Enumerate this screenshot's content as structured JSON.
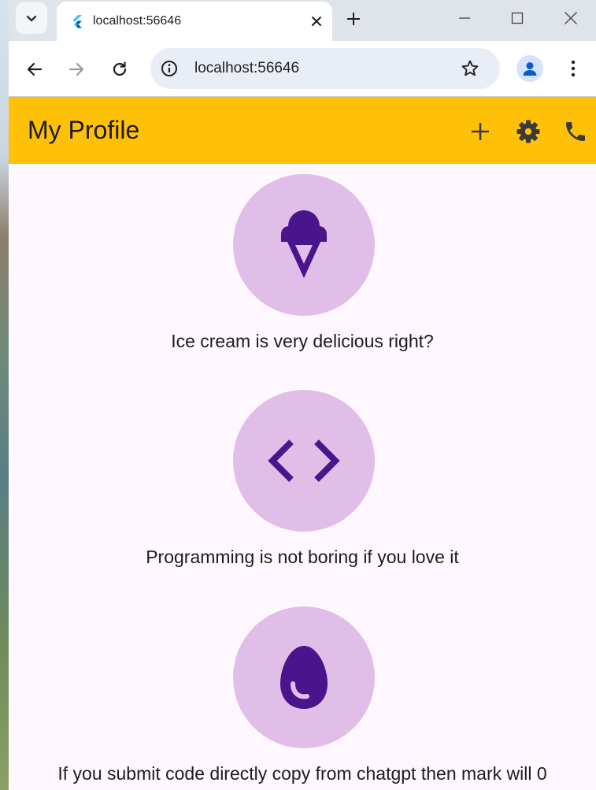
{
  "tab": {
    "title": "localhost:56646"
  },
  "address_bar": {
    "url": "localhost:56646"
  },
  "appbar": {
    "title": "My Profile"
  },
  "icons": {
    "tab_search": "chevron-down-icon",
    "favicon": "flutter-icon",
    "tab_close": "close-icon",
    "new_tab": "plus-icon",
    "back": "arrow-left-icon",
    "forward": "arrow-right-icon",
    "reload": "reload-icon",
    "site_info": "info-icon",
    "bookmark": "star-icon",
    "profile": "account-icon",
    "menu": "more-vertical-icon",
    "appbar_actions": [
      "add-icon",
      "settings-icon",
      "phone-icon"
    ]
  },
  "cards": [
    {
      "icon": "icecream-icon",
      "caption": "Ice cream is very delicious right?"
    },
    {
      "icon": "code-icon",
      "caption": "Programming is not boring if you love it"
    },
    {
      "icon": "egg-icon",
      "caption": "If you submit code directly copy from chatgpt then mark will 0"
    }
  ],
  "colors": {
    "appbar": "#ffc107",
    "app_background": "#fff7fe",
    "avatar_background": "#e1bee7",
    "avatar_icon": "#4a148c",
    "browser_frame": "#dfe3ea"
  }
}
